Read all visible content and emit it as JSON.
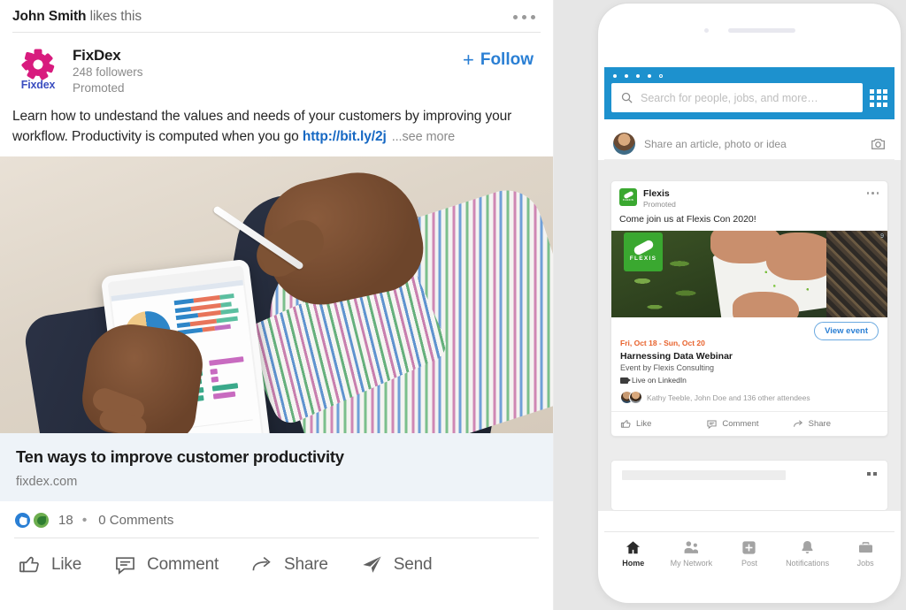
{
  "desktop_post": {
    "likes_actor": "John Smith",
    "likes_suffix": " likes this",
    "menu_icon": "overflow-menu-icon",
    "author": {
      "logo_word": "Fixdex",
      "name": "FixDex",
      "followers": "248 followers",
      "promoted": "Promoted"
    },
    "follow": {
      "plus": "+",
      "label": "Follow"
    },
    "text_part1": "Learn how to undestand the values and needs of your customers by improving your workflow. Productivity is computed when you go ",
    "link": "http://bit.ly/2j",
    "see_more": "...see more",
    "link_preview": {
      "title": "Ten ways to improve customer productivity",
      "domain": "fixdex.com"
    },
    "counts": {
      "reactions": "18",
      "separator": "•",
      "comments": "0 Comments"
    },
    "actions": [
      {
        "label": "Like",
        "icon": "thumbs-up-icon"
      },
      {
        "label": "Comment",
        "icon": "comment-bubble-icon"
      },
      {
        "label": "Share",
        "icon": "share-arrow-icon"
      },
      {
        "label": "Send",
        "icon": "send-paper-plane-icon"
      }
    ]
  },
  "phone": {
    "search": {
      "placeholder": "Search for people, jobs, and more…",
      "icon": "search-icon",
      "grid_icon": "app-grid-icon"
    },
    "share_box": {
      "placeholder": "Share an article, photo or idea",
      "camera_icon": "camera-icon",
      "avatar": "user-avatar"
    },
    "flexis_card": {
      "logo_word": "FLEXIS",
      "name": "Flexis",
      "promoted": "Promoted",
      "menu_icon": "overflow-menu-icon",
      "post_text": "Come join us at Flexis Con 2020!",
      "view_event": "View event",
      "event_date": "Fri, Oct 18 - Sun, Oct 20",
      "event_title": "Harnessing Data Webinar",
      "event_by": "Event by Flexis Consulting",
      "live_label": "Live on LinkedIn",
      "attendees": "Kathy Teeble, John Doe and 136 other attendees",
      "actions": [
        {
          "label": "Like",
          "icon": "thumbs-up-icon"
        },
        {
          "label": "Comment",
          "icon": "comment-bubble-icon"
        },
        {
          "label": "Share",
          "icon": "share-arrow-icon"
        }
      ]
    },
    "tabs": [
      {
        "label": "Home",
        "icon": "home-icon",
        "active": true
      },
      {
        "label": "My Network",
        "icon": "people-icon",
        "active": false
      },
      {
        "label": "Post",
        "icon": "plus-square-icon",
        "active": false
      },
      {
        "label": "Notifications",
        "icon": "bell-icon",
        "active": false
      },
      {
        "label": "Jobs",
        "icon": "briefcase-icon",
        "active": false
      }
    ]
  },
  "colors": {
    "linkedin_blue": "#1d91ce",
    "link_blue": "#1668c3",
    "follow_blue": "#2a7fd4",
    "flexis_green": "#3aa830",
    "event_orange": "#e8622c",
    "fixdex_pink": "#d81b7e",
    "fixdex_wordmark_blue": "#3b4ec0"
  }
}
